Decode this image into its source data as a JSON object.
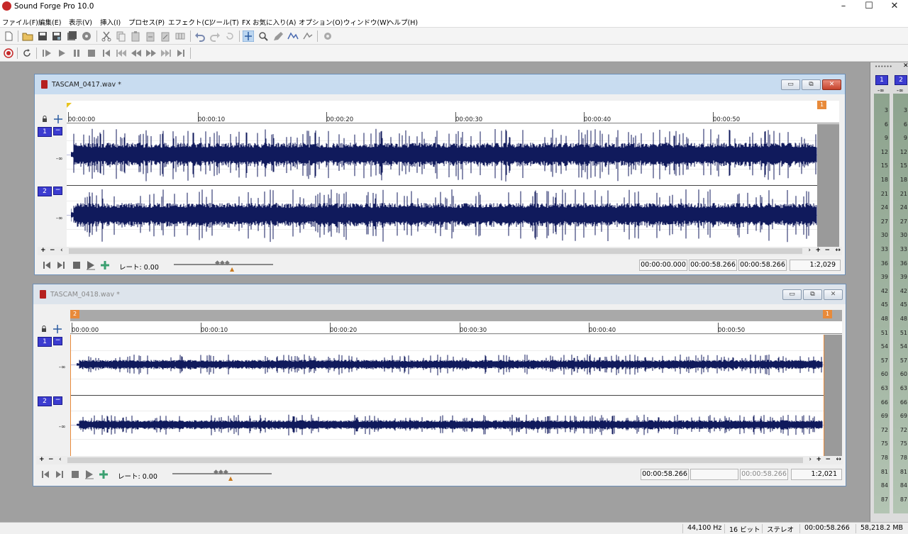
{
  "app": {
    "title": "Sound Forge Pro 10.0"
  },
  "window_controls": {
    "minimize": "–",
    "maximize": "☐",
    "close": "✕"
  },
  "menu": [
    "ファイル(F)",
    "編集(E)",
    "表示(V)",
    "挿入(I)",
    "プロセス(P)",
    "エフェクト(C)",
    "ツール(T)",
    "FX お気に入り(A)",
    "オプション(O)",
    "ウィンドウ(W)",
    "ヘルプ(H)"
  ],
  "doc1": {
    "title": "TASCAM_0417.wav *",
    "ruler": [
      "00:00:00",
      "00:00:10",
      "00:00:20",
      "00:00:30",
      "00:00:40",
      "00:00:50"
    ],
    "marker_end": "1",
    "channels": [
      "1",
      "2"
    ],
    "db_label": "-∞",
    "rate_label": "レート: 0.00",
    "sel_start": "00:00:00.000",
    "sel_end": "00:00:58.266",
    "sel_length": "00:00:58.266",
    "zoom": "1:2,029"
  },
  "doc2": {
    "title": "TASCAM_0418.wav *",
    "ruler": [
      "00:00:00",
      "00:00:10",
      "00:00:20",
      "00:00:30",
      "00:00:40",
      "00:00:50"
    ],
    "marker_start": "2",
    "marker_end": "1",
    "channels": [
      "1",
      "2"
    ],
    "db_label": "-∞",
    "rate_label": "レート: 0.00",
    "sel_start": "00:00:58.266",
    "sel_end": "",
    "sel_length": "00:00:58.266",
    "zoom": "1:2,021"
  },
  "meters": {
    "grip": "••••••",
    "close": "✕",
    "ch1": "1",
    "ch2": "2",
    "peak": "-∞",
    "scale": [
      "3",
      "6",
      "9",
      "12",
      "15",
      "18",
      "21",
      "24",
      "27",
      "30",
      "33",
      "36",
      "39",
      "42",
      "45",
      "48",
      "51",
      "54",
      "57",
      "60",
      "63",
      "66",
      "69",
      "72",
      "75",
      "78",
      "81",
      "84",
      "87"
    ]
  },
  "status": {
    "sample_rate": "44,100 Hz",
    "bit_depth": "16 ビット",
    "channels": "ステレオ",
    "length": "00:00:58.266",
    "disk": "58,218.2 MB"
  }
}
